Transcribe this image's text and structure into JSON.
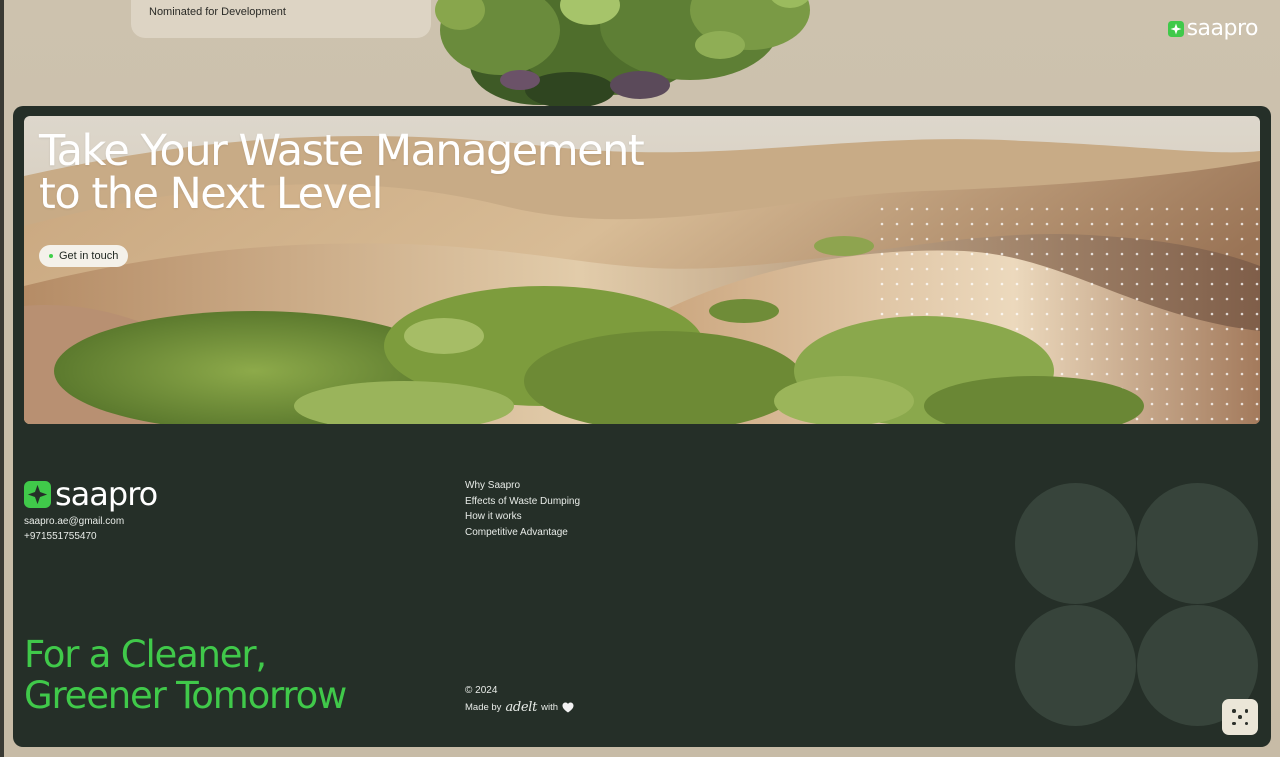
{
  "top": {
    "nomination_text": "Nominated for Development",
    "logo_text": "saapro"
  },
  "hero": {
    "title_line1": "Take Your Waste Management",
    "title_line2": "to the Next Level",
    "cta_label": "Get in touch"
  },
  "footer": {
    "logo_text": "saapro",
    "email": "saapro.ae@gmail.com",
    "phone": "+971551755470",
    "nav": [
      {
        "label": "Why Saapro"
      },
      {
        "label": "Effects of Waste Dumping"
      },
      {
        "label": "How it works"
      },
      {
        "label": "Competitive Advantage"
      }
    ],
    "tagline_line1": "For a Cleaner,",
    "tagline_line2": "Greener Tomorrow",
    "copyright": "© 2024",
    "made_by_prefix": "Made by",
    "made_by_brand": "adelt",
    "made_by_suffix": "with"
  },
  "icons": {
    "logo": "sparkle-logo-icon",
    "heart": "heart-icon",
    "fab": "dice-dots-icon"
  },
  "colors": {
    "brand_green": "#40c94a",
    "panel_dark": "#252f28",
    "circle": "#37443b",
    "page_bg": "#cdc2ae"
  }
}
